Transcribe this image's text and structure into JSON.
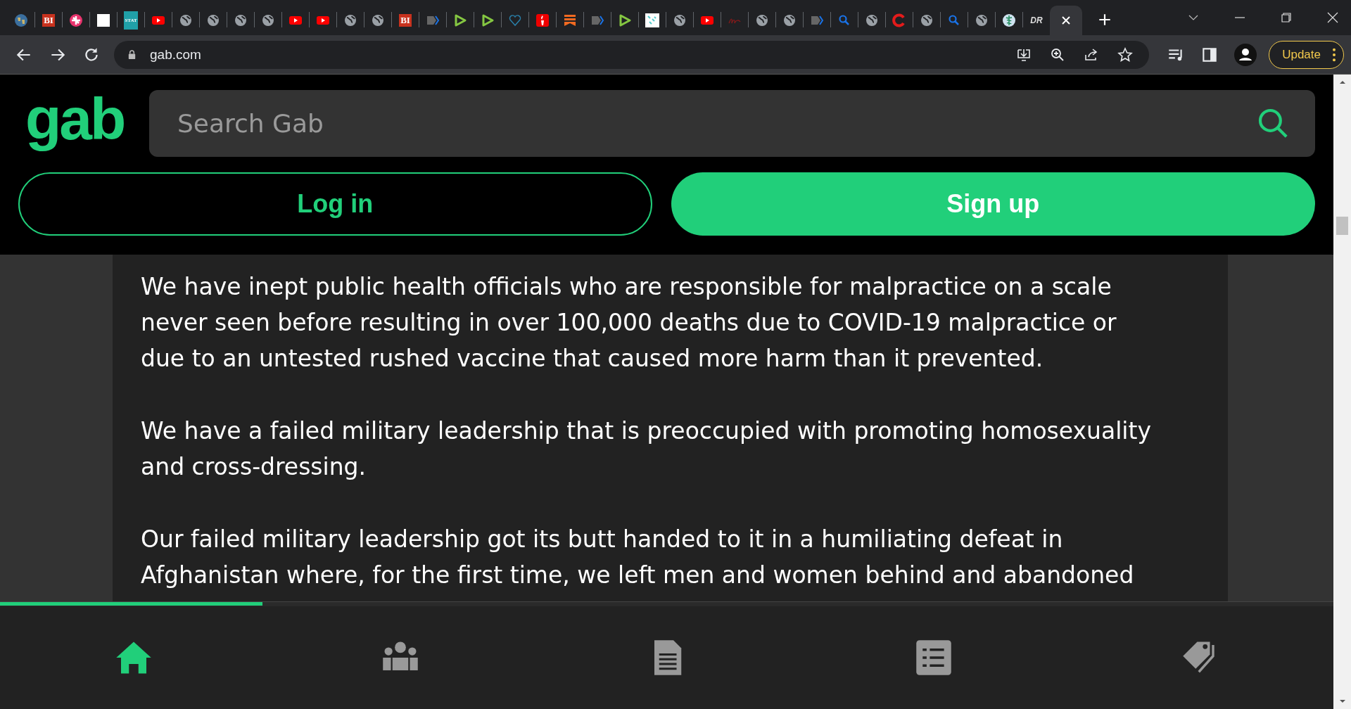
{
  "browser": {
    "tabs": [
      {
        "kind": "earth",
        "selected": false
      },
      {
        "kind": "letters",
        "label": "BI",
        "selected": false
      },
      {
        "kind": "pinwheel",
        "selected": false
      },
      {
        "kind": "white",
        "selected": false
      },
      {
        "kind": "letters-teal",
        "label": "STAT",
        "selected": false
      },
      {
        "kind": "youtube",
        "selected": false
      },
      {
        "kind": "globe",
        "selected": false
      },
      {
        "kind": "globe",
        "selected": false
      },
      {
        "kind": "globe",
        "selected": false
      },
      {
        "kind": "globe",
        "selected": false
      },
      {
        "kind": "youtube",
        "selected": false
      },
      {
        "kind": "youtube",
        "selected": false
      },
      {
        "kind": "globe",
        "selected": false
      },
      {
        "kind": "globe",
        "selected": false
      },
      {
        "kind": "letters",
        "label": "BI",
        "selected": false
      },
      {
        "kind": "chevron",
        "selected": false
      },
      {
        "kind": "play",
        "selected": false
      },
      {
        "kind": "play",
        "selected": false
      },
      {
        "kind": "heart",
        "selected": false
      },
      {
        "kind": "torch",
        "selected": false
      },
      {
        "kind": "bars",
        "selected": false
      },
      {
        "kind": "chevron",
        "selected": false
      },
      {
        "kind": "play",
        "selected": false
      },
      {
        "kind": "grid",
        "selected": false
      },
      {
        "kind": "globe",
        "selected": false
      },
      {
        "kind": "youtube",
        "selected": false
      },
      {
        "kind": "scribble",
        "selected": false
      },
      {
        "kind": "globe",
        "selected": false
      },
      {
        "kind": "globe",
        "selected": false
      },
      {
        "kind": "chevron",
        "selected": false
      },
      {
        "kind": "search",
        "selected": false
      },
      {
        "kind": "globe",
        "selected": false
      },
      {
        "kind": "ring",
        "selected": false
      },
      {
        "kind": "globe",
        "selected": false
      },
      {
        "kind": "search",
        "selected": false
      },
      {
        "kind": "globe",
        "selected": false
      },
      {
        "kind": "caduceus",
        "selected": false
      },
      {
        "kind": "letters-italic",
        "label": "DR",
        "selected": false
      },
      {
        "kind": "close",
        "selected": true
      }
    ],
    "url": "gab.com",
    "update_button": "Update"
  },
  "header": {
    "logo": "gab",
    "search": {
      "placeholder": "Search Gab"
    },
    "login_button": "Log in",
    "signup_button": "Sign up"
  },
  "post": {
    "paragraphs": [
      "We have inept public health officials who are responsible for malpractice on a scale never seen before resulting in over 100,000 deaths due to COVID-19 malpractice or due to an untested rushed vaccine that caused more harm than it prevented.",
      "We have a failed military leadership that is preoccupied with promoting homosexuality and cross-dressing.",
      "Our failed military leadership got its butt handed to it in a humiliating defeat in Afghanistan where, for the first time, we left men and women behind and abandoned"
    ]
  },
  "bottom_nav": {
    "progress": {
      "level": 0.197
    },
    "items": [
      {
        "kind": "home",
        "selected": true
      },
      {
        "kind": "people",
        "selected": false
      },
      {
        "kind": "document",
        "selected": false
      },
      {
        "kind": "list",
        "selected": false
      },
      {
        "kind": "tags",
        "selected": false
      }
    ]
  }
}
